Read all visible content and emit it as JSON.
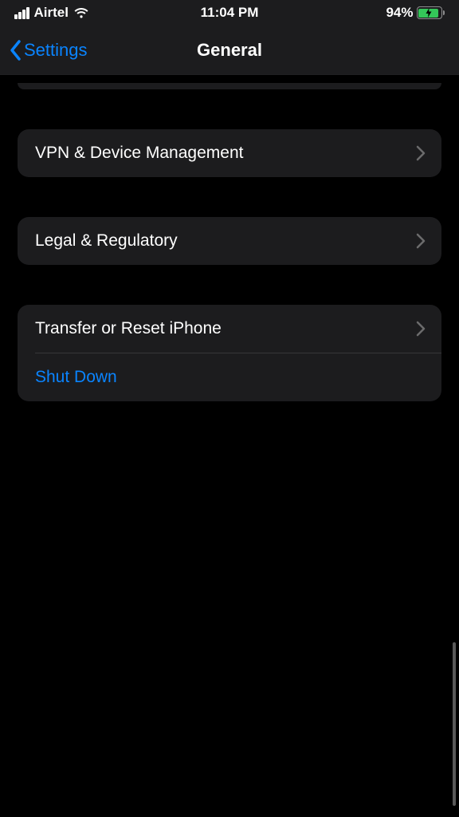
{
  "statusBar": {
    "carrier": "Airtel",
    "time": "11:04 PM",
    "batteryPercent": "94%"
  },
  "nav": {
    "back": "Settings",
    "title": "General"
  },
  "rows": {
    "vpn": "VPN & Device Management",
    "legal": "Legal & Regulatory",
    "transfer": "Transfer or Reset iPhone",
    "shutdown": "Shut Down"
  },
  "colors": {
    "accent": "#0a84ff",
    "cell": "#1c1c1e",
    "batteryFill": "#34c759"
  }
}
